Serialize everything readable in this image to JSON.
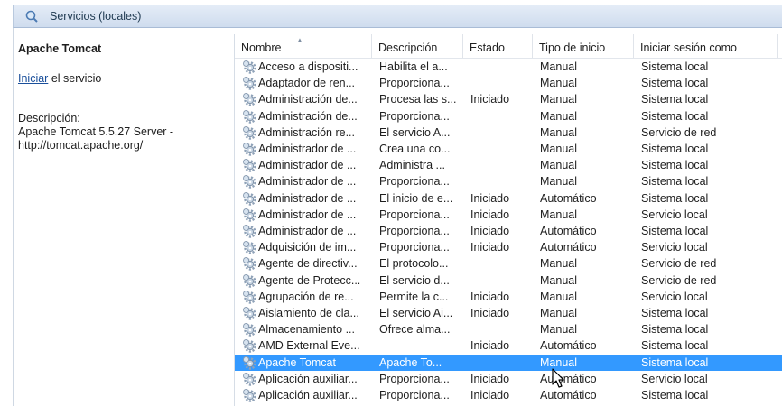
{
  "window": {
    "title": "Servicios (locales)"
  },
  "left_panel": {
    "service_name": "Apache Tomcat",
    "start_link": "Iniciar",
    "start_suffix": " el servicio",
    "description_label": "Descripción:",
    "description_text": "Apache Tomcat 5.5.27 Server - http://tomcat.apache.org/"
  },
  "columns": {
    "name": "Nombre",
    "description": "Descripción",
    "state": "Estado",
    "startup_type": "Tipo de inicio",
    "logon_as": "Iniciar sesión como"
  },
  "selected_row_index": 18,
  "services": [
    {
      "name": "Acceso a dispositi...",
      "description": "Habilita el a...",
      "state": "",
      "startup": "Manual",
      "logon": "Sistema local"
    },
    {
      "name": "Adaptador de ren...",
      "description": "Proporciona...",
      "state": "",
      "startup": "Manual",
      "logon": "Sistema local"
    },
    {
      "name": "Administración de...",
      "description": "Procesa las s...",
      "state": "Iniciado",
      "startup": "Manual",
      "logon": "Sistema local"
    },
    {
      "name": "Administración de...",
      "description": "Proporciona...",
      "state": "",
      "startup": "Manual",
      "logon": "Sistema local"
    },
    {
      "name": "Administración re...",
      "description": "El servicio A...",
      "state": "",
      "startup": "Manual",
      "logon": "Servicio de red"
    },
    {
      "name": "Administrador de ...",
      "description": "Crea una co...",
      "state": "",
      "startup": "Manual",
      "logon": "Sistema local"
    },
    {
      "name": "Administrador de ...",
      "description": "Administra ...",
      "state": "",
      "startup": "Manual",
      "logon": "Sistema local"
    },
    {
      "name": "Administrador de ...",
      "description": "Proporciona...",
      "state": "",
      "startup": "Manual",
      "logon": "Sistema local"
    },
    {
      "name": "Administrador de ...",
      "description": "El inicio de e...",
      "state": "Iniciado",
      "startup": "Automático",
      "logon": "Sistema local"
    },
    {
      "name": "Administrador de ...",
      "description": "Proporciona...",
      "state": "Iniciado",
      "startup": "Manual",
      "logon": "Servicio local"
    },
    {
      "name": "Administrador de ...",
      "description": "Proporciona...",
      "state": "Iniciado",
      "startup": "Automático",
      "logon": "Sistema local"
    },
    {
      "name": "Adquisición de im...",
      "description": "Proporciona...",
      "state": "Iniciado",
      "startup": "Automático",
      "logon": "Servicio local"
    },
    {
      "name": "Agente de directiv...",
      "description": "El protocolo...",
      "state": "",
      "startup": "Manual",
      "logon": "Servicio de red"
    },
    {
      "name": "Agente de Protecc...",
      "description": "El servicio d...",
      "state": "",
      "startup": "Manual",
      "logon": "Servicio de red"
    },
    {
      "name": "Agrupación de re...",
      "description": "Permite la c...",
      "state": "Iniciado",
      "startup": "Manual",
      "logon": "Servicio local"
    },
    {
      "name": "Aislamiento de cla...",
      "description": "El servicio Ai...",
      "state": "Iniciado",
      "startup": "Manual",
      "logon": "Sistema local"
    },
    {
      "name": "Almacenamiento ...",
      "description": "Ofrece alma...",
      "state": "",
      "startup": "Manual",
      "logon": "Sistema local"
    },
    {
      "name": "AMD External Eve...",
      "description": "",
      "state": "Iniciado",
      "startup": "Automático",
      "logon": "Sistema local"
    },
    {
      "name": "Apache Tomcat",
      "description": "Apache To...",
      "state": "",
      "startup": "Manual",
      "logon": "Sistema local"
    },
    {
      "name": "Aplicación auxiliar...",
      "description": "Proporciona...",
      "state": "Iniciado",
      "startup": "Automático",
      "logon": "Servicio local"
    },
    {
      "name": "Aplicación auxiliar...",
      "description": "Proporciona...",
      "state": "Iniciado",
      "startup": "Automático",
      "logon": "Sistema local"
    }
  ]
}
